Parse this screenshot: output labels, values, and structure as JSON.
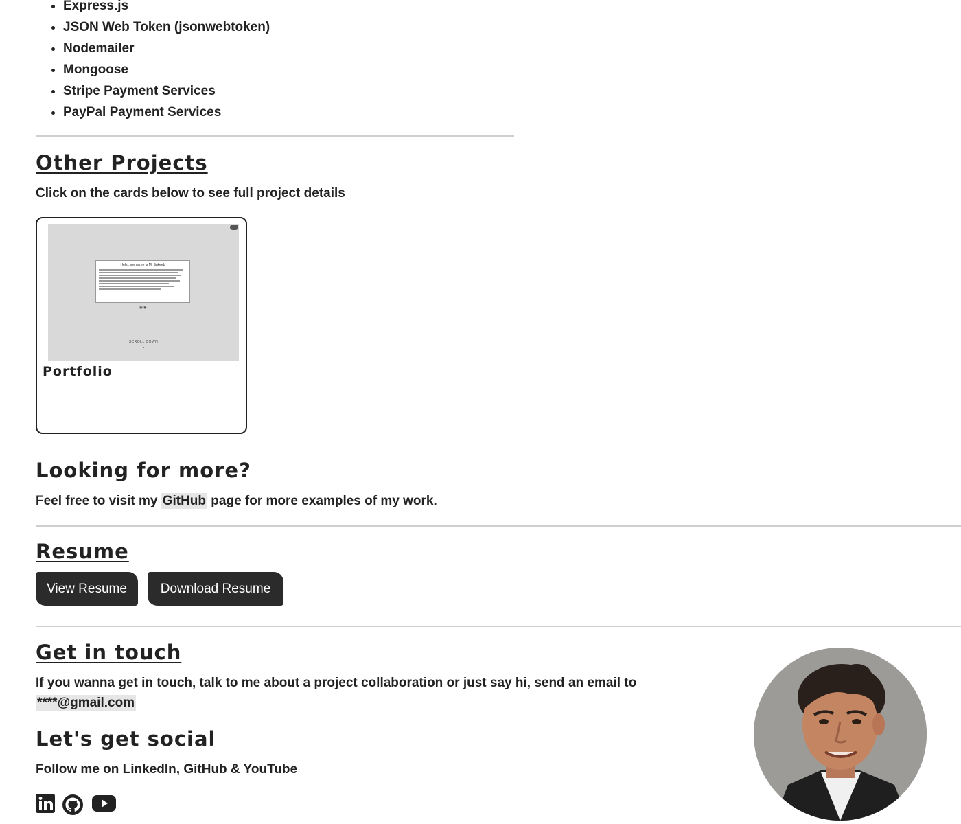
{
  "tech_stack": [
    "Express.js",
    "JSON Web Token (jsonwebtoken)",
    "Nodemailer",
    "Mongoose",
    "Stripe Payment Services",
    "PayPal Payment Services"
  ],
  "other_projects": {
    "heading": "Other Projects",
    "subtitle": "Click on the cards below to see full project details",
    "card": {
      "title": "Portfolio",
      "thumbnail": {
        "greeting": "Hello, my name is M. Sakeeb",
        "scroll_label": "SCROLL DOWN"
      }
    }
  },
  "more": {
    "heading": "Looking for more?",
    "text_before": "Feel free to visit my ",
    "link": "GitHub",
    "text_after": " page for more examples of my work."
  },
  "resume": {
    "heading": "Resume",
    "view_label": "View Resume",
    "download_label": "Download Resume"
  },
  "contact": {
    "heading": "Get in touch",
    "text": "If you wanna get in touch, talk to me about a project collaboration or just say hi, send an email to",
    "email": "****@gmail.com"
  },
  "social": {
    "heading": "Let's get social",
    "text": "Follow me on LinkedIn, GitHub & YouTube",
    "icons": [
      "linkedin-icon",
      "github-icon",
      "youtube-icon"
    ]
  },
  "colors": {
    "text": "#222222",
    "button_bg": "#2b2b2b",
    "highlight_bg": "#e6e6e6",
    "divider": "#cfcfcf"
  }
}
